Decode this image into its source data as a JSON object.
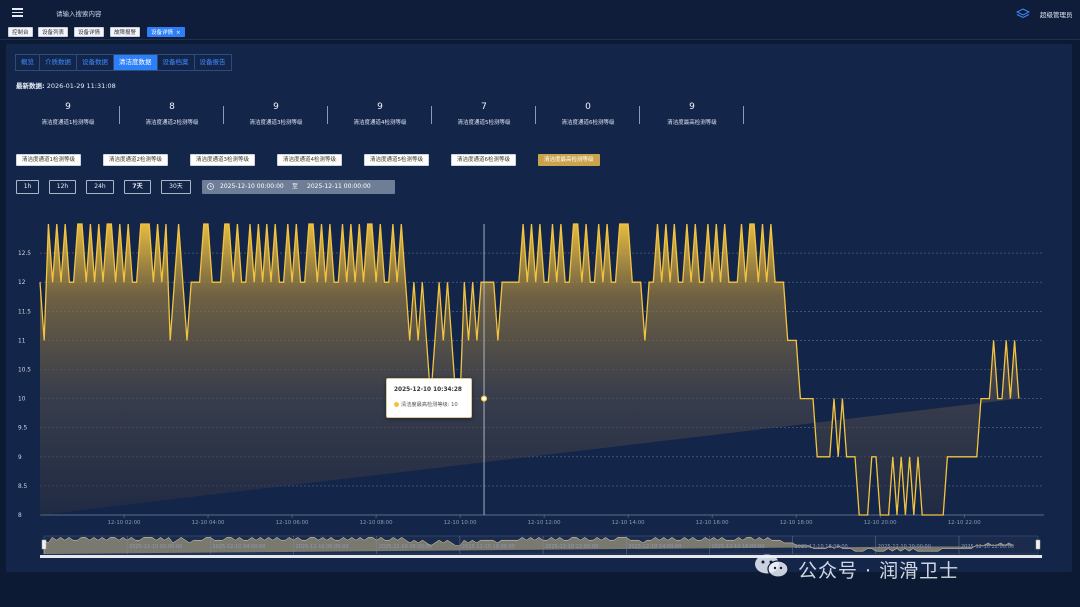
{
  "header": {
    "search_placeholder": "请输入搜索内容",
    "user": "超级管理员",
    "icons": {
      "menu": "hamburger-icon",
      "theme": "layers-icon"
    }
  },
  "tags": [
    {
      "label": "控制台",
      "active": false
    },
    {
      "label": "设备列表",
      "active": false
    },
    {
      "label": "设备详情",
      "active": false
    },
    {
      "label": "故障报警",
      "active": false
    },
    {
      "label": "设备详情",
      "active": true,
      "close": "×"
    }
  ],
  "subtabs": [
    {
      "label": "概览",
      "active": false
    },
    {
      "label": "介质数据",
      "active": false
    },
    {
      "label": "设备数据",
      "active": false
    },
    {
      "label": "清洁度数据",
      "active": true
    },
    {
      "label": "设备档案",
      "active": false
    },
    {
      "label": "设备报告",
      "active": false
    }
  ],
  "latest": {
    "label": "最新数据:",
    "time": "2026-01-29 11:31:08"
  },
  "stats": [
    {
      "value": "9",
      "label": "清洁度通道1检测等级"
    },
    {
      "value": "8",
      "label": "清洁度通道2检测等级"
    },
    {
      "value": "9",
      "label": "清洁度通道3检测等级"
    },
    {
      "value": "9",
      "label": "清洁度通道4检测等级"
    },
    {
      "value": "7",
      "label": "清洁度通道5检测等级"
    },
    {
      "value": "0",
      "label": "清洁度通道6检测等级"
    },
    {
      "value": "9",
      "label": "清洁度最高检测等级"
    }
  ],
  "filters": [
    {
      "label": "清洁度通道1检测等级",
      "active": false
    },
    {
      "label": "清洁度通道2检测等级",
      "active": false
    },
    {
      "label": "清洁度通道3检测等级",
      "active": false
    },
    {
      "label": "清洁度通道4检测等级",
      "active": false
    },
    {
      "label": "清洁度通道5检测等级",
      "active": false
    },
    {
      "label": "清洁度通道6检测等级",
      "active": false
    },
    {
      "label": "清洁度最高检测等级",
      "active": true
    }
  ],
  "time_buttons": [
    {
      "label": "1h",
      "active": false
    },
    {
      "label": "12h",
      "active": false
    },
    {
      "label": "24h",
      "active": false
    },
    {
      "label": "7天",
      "active": true
    },
    {
      "label": "30天",
      "active": false
    }
  ],
  "date_range": {
    "start": "2025-12-10 00:00:00",
    "to": "至",
    "end": "2025-12-11 00:00:00",
    "icon": "calendar-icon"
  },
  "tooltip": {
    "time": "2025-12-10 10:34:28",
    "series": "清洁度最高检测等级",
    "value": "10"
  },
  "chart_data": {
    "type": "area",
    "series": [
      {
        "name": "清洁度最高检测等级"
      }
    ],
    "color": "#f2c440",
    "ylim": [
      8,
      13
    ],
    "yticks": [
      8,
      8.5,
      9,
      9.5,
      10,
      10.5,
      11,
      11.5,
      12,
      12.5
    ],
    "xticks": [
      "12-10 02:00",
      "12-10 04:00",
      "12-10 06:00",
      "12-10 08:00",
      "12-10 10:00",
      "12-10 12:00",
      "12-10 14:00",
      "12-10 16:00",
      "12-10 18:00",
      "12-10 20:00",
      "12-10 22:00"
    ],
    "x_hours": [
      0,
      0.1,
      0.2,
      0.3,
      0.4,
      0.5,
      0.6,
      0.7,
      0.8,
      0.9,
      1.0,
      1.1,
      1.2,
      1.3,
      1.4,
      1.5,
      1.6,
      1.7,
      1.8,
      1.9,
      2.0,
      2.1,
      2.2,
      2.3,
      2.4,
      2.5,
      2.6,
      2.7,
      2.8,
      2.9,
      3.0,
      3.1,
      3.2,
      3.3,
      3.4,
      3.5,
      3.6,
      3.7,
      3.8,
      3.9,
      4.0,
      4.1,
      4.2,
      4.3,
      4.4,
      4.5,
      4.6,
      4.7,
      4.8,
      4.9,
      5.0,
      5.1,
      5.2,
      5.3,
      5.4,
      5.5,
      5.6,
      5.7,
      5.8,
      5.9,
      6.0,
      6.1,
      6.2,
      6.3,
      6.4,
      6.5,
      6.6,
      6.7,
      6.8,
      6.9,
      7.0,
      7.1,
      7.2,
      7.3,
      7.4,
      7.5,
      7.6,
      7.7,
      7.8,
      7.9,
      8.0,
      8.1,
      8.2,
      8.3,
      8.4,
      8.5,
      8.6,
      8.7,
      8.8,
      8.9,
      9.0,
      9.1,
      9.2,
      9.3,
      9.4,
      9.5,
      9.6,
      9.7,
      9.8,
      9.9,
      10.0,
      10.1,
      10.2,
      10.3,
      10.4,
      10.5,
      10.6,
      10.7,
      10.8,
      10.9,
      11.0,
      11.1,
      11.2,
      11.3,
      11.4,
      11.5,
      11.6,
      11.7,
      11.8,
      11.9,
      12.0,
      12.1,
      12.2,
      12.3,
      12.4,
      12.5,
      12.6,
      12.7,
      12.8,
      12.9,
      13.0,
      13.1,
      13.2,
      13.3,
      13.4,
      13.5,
      13.6,
      13.7,
      13.8,
      13.9,
      14.0,
      14.1,
      14.2,
      14.3,
      14.4,
      14.5,
      14.6,
      14.7,
      14.8,
      14.9,
      15.0,
      15.1,
      15.2,
      15.3,
      15.4,
      15.5,
      15.6,
      15.7,
      15.8,
      15.9,
      16.0,
      16.1,
      16.2,
      16.3,
      16.4,
      16.5,
      16.6,
      16.7,
      16.8,
      16.9,
      17.0,
      17.1,
      17.2,
      17.3,
      17.4,
      17.5,
      17.6,
      17.7,
      17.8,
      17.9,
      18.0,
      18.1,
      18.2,
      18.3,
      18.4,
      18.5,
      18.6,
      18.7,
      18.8,
      18.9,
      19.0,
      19.1,
      19.2,
      19.3,
      19.4,
      19.5,
      19.6,
      19.7,
      19.8,
      19.9,
      20.0,
      20.1,
      20.2,
      20.3,
      20.4,
      20.5,
      20.6,
      20.7,
      20.8,
      20.9,
      21.0,
      21.1,
      21.2,
      21.3,
      21.4,
      21.5,
      21.6,
      21.7,
      21.8,
      21.9,
      22.0,
      22.1,
      22.2,
      22.3,
      22.4,
      22.5,
      22.6,
      22.7,
      22.8,
      22.9,
      23.0,
      23.1,
      23.2,
      23.3,
      23.4,
      23.5,
      23.6,
      23.7,
      23.8,
      23.9
    ],
    "values": [
      12,
      11,
      13,
      12,
      13,
      12,
      13,
      12,
      12,
      13,
      13,
      12,
      13,
      12,
      13,
      12,
      13,
      13,
      12,
      13,
      12,
      13,
      12,
      12,
      13,
      13,
      13,
      12,
      13,
      12,
      13,
      11,
      12,
      13,
      12,
      11,
      12,
      12,
      12,
      13,
      13,
      12,
      12,
      12,
      13,
      13,
      12,
      13,
      12,
      12,
      13,
      12,
      13,
      12,
      13,
      12,
      13,
      12,
      12,
      13,
      12,
      13,
      12,
      12,
      13,
      13,
      12,
      13,
      12,
      13,
      12,
      12,
      13,
      12,
      13,
      12,
      13,
      12,
      13,
      13,
      12,
      13,
      12,
      12,
      13,
      12,
      13,
      12,
      11,
      12,
      11,
      12,
      11,
      10,
      11,
      12,
      11,
      12,
      11,
      10,
      10,
      12,
      11,
      12,
      11,
      12,
      12,
      12,
      12,
      11,
      12,
      12,
      12,
      12,
      12,
      13,
      12,
      13,
      12,
      13,
      12,
      12,
      13,
      12,
      13,
      12,
      12,
      13,
      13,
      12,
      13,
      12,
      12,
      13,
      12,
      13,
      12,
      12,
      13,
      13,
      13,
      12,
      12,
      12,
      11,
      12,
      12,
      13,
      12,
      13,
      12,
      13,
      12,
      12,
      13,
      12,
      13,
      12,
      12,
      13,
      12,
      13,
      12,
      13,
      12,
      12,
      12,
      13,
      12,
      13,
      13,
      12,
      13,
      12,
      13,
      12,
      12,
      12,
      11,
      11,
      11,
      10,
      10,
      10,
      10,
      9,
      9,
      9,
      9,
      10,
      9,
      10,
      9,
      9,
      9,
      8,
      8,
      8,
      9,
      9,
      8,
      8,
      8,
      9,
      8,
      9,
      8,
      9,
      8,
      9,
      8,
      8,
      8,
      8,
      8,
      8,
      9,
      9,
      9,
      9,
      9,
      9,
      9,
      9,
      10,
      10,
      10,
      11,
      10,
      10,
      11,
      10,
      11,
      10
    ],
    "grid": true,
    "slider_labels": [
      "2025-12-10 02:00:00",
      "2025-12-10 04:00:00",
      "2025-12-10 06:00:00",
      "2025-12-10 08:00:00",
      "2025-12-10 10:00:00",
      "2025-12-10 12:00:00",
      "2025-12-10 14:00:00",
      "2025-12-10 16:00:00",
      "2025-12-10 18:00:00",
      "2025-12-10 20:00:00",
      "2025-12-10 22:00:00"
    ]
  },
  "watermark": {
    "text": "公众号 · 润滑卫士",
    "icon": "wechat-icon"
  }
}
